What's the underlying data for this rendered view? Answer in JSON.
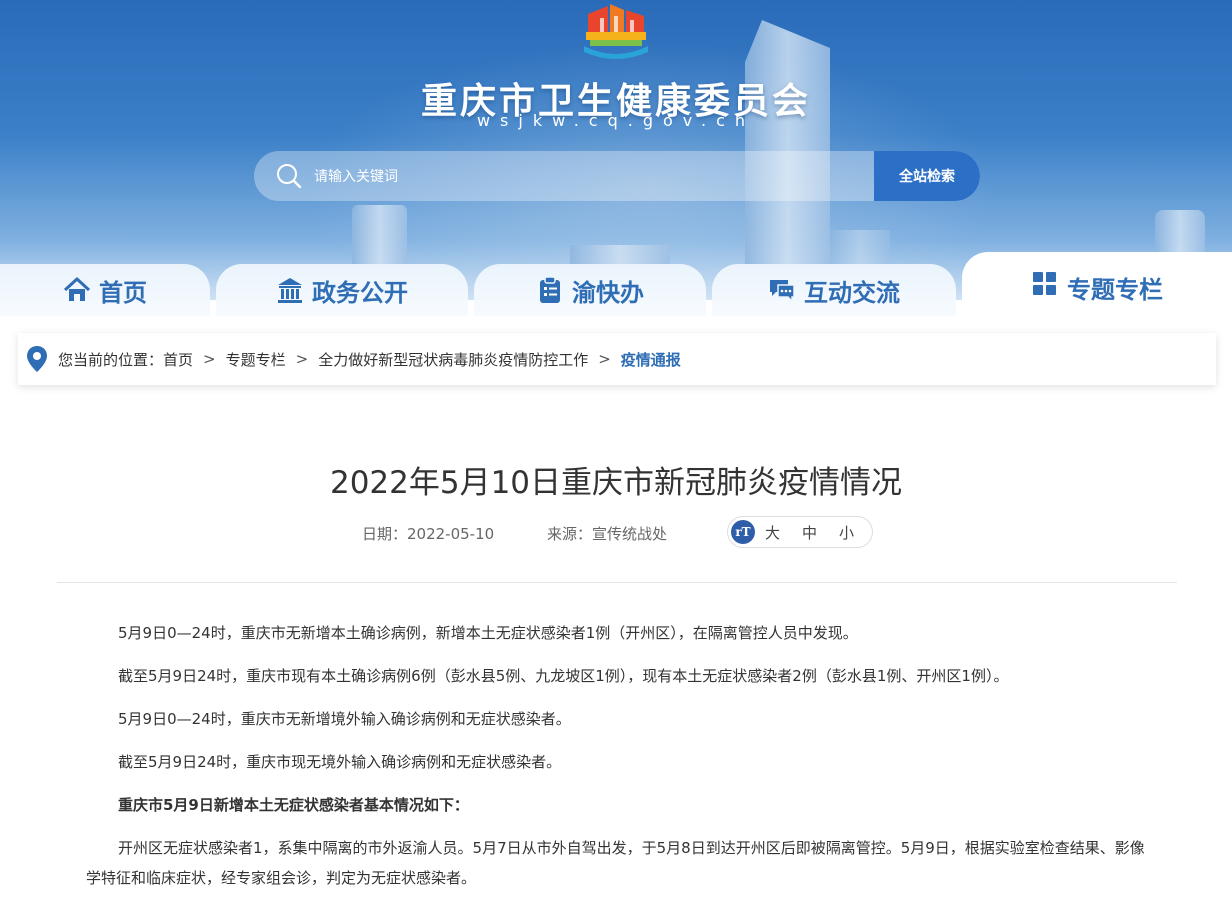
{
  "header": {
    "site_title": "重庆市卫生健康委员会",
    "site_domain": "wsjkw.cq.gov.cn",
    "logo_icon": "government-building-logo-icon"
  },
  "search": {
    "placeholder": "请输入关键词",
    "button_label": "全站检索"
  },
  "nav": {
    "items": [
      {
        "label": "首页",
        "icon": "home-icon"
      },
      {
        "label": "政务公开",
        "icon": "government-building-icon"
      },
      {
        "label": "渝快办",
        "icon": "clipboard-icon"
      },
      {
        "label": "互动交流",
        "icon": "chat-icon"
      },
      {
        "label": "专题专栏",
        "icon": "grid-icon",
        "active": true
      }
    ]
  },
  "breadcrumb": {
    "prefix": "您当前的位置：",
    "items": [
      "首页",
      "专题专栏",
      "全力做好新型冠状病毒肺炎疫情防控工作"
    ],
    "current": "疫情通报",
    "separator": ">"
  },
  "article": {
    "title": "2022年5月10日重庆市新冠肺炎疫情情况",
    "date_label": "日期：2022-05-10",
    "source_label": "来源：宣传统战处",
    "font_size": {
      "icon_text": "rT",
      "large": "大",
      "medium": "中",
      "small": "小"
    },
    "paragraphs": [
      "5月9日0—24时，重庆市无新增本土确诊病例，新增本土无症状感染者1例（开州区），在隔离管控人员中发现。",
      "截至5月9日24时，重庆市现有本土确诊病例6例（彭水县5例、九龙坡区1例），现有本土无症状感染者2例（彭水县1例、开州区1例）。",
      "5月9日0—24时，重庆市无新增境外输入确诊病例和无症状感染者。",
      "截至5月9日24时，重庆市现无境外输入确诊病例和无症状感染者。",
      "重庆市5月9日新增本土无症状感染者基本情况如下：",
      "开州区无症状感染者1，系集中隔离的市外返渝人员。5月7日从市外自驾出发，于5月8日到达开州区后即被隔离管控。5月9日，根据实验室检查结果、影像学特征和临床症状，经专家组会诊，判定为无症状感染者。"
    ]
  },
  "colors": {
    "brand_blue": "#2f6db5",
    "search_button": "#2c6fc6"
  }
}
